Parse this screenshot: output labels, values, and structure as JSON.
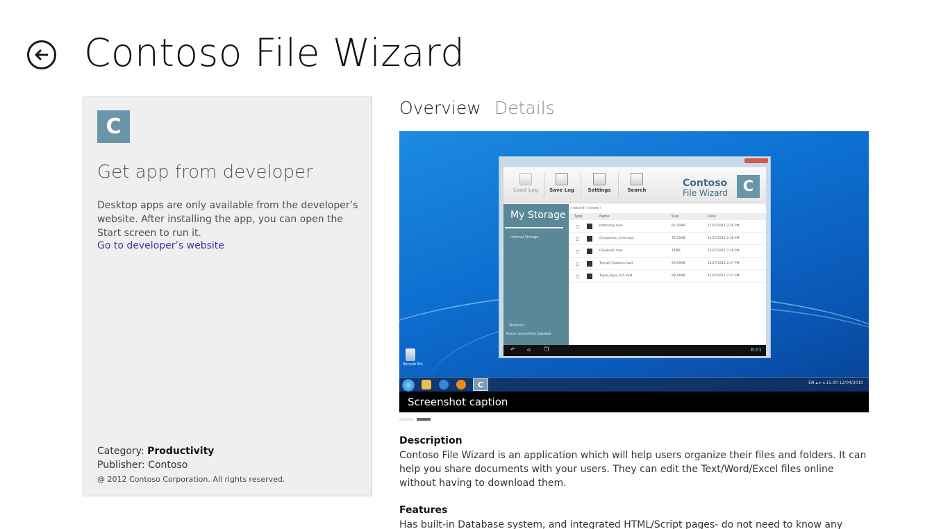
{
  "header": {
    "title": "Contoso File Wizard"
  },
  "card": {
    "tile_letter": "C",
    "heading": "Get app from developer",
    "description": "Desktop apps are only available from the developer’s website. After installing the app, you can open the Start screen to run it.",
    "link": "Go to developer’s website",
    "category_label": "Category:",
    "category_value": "Productivity",
    "publisher_label": "Publisher:",
    "publisher_value": "Contoso",
    "copyright": "@ 2012 Contoso Corporation. All rights reserved."
  },
  "tabs": [
    {
      "label": "Overview",
      "active": true
    },
    {
      "label": "Details",
      "active": false
    }
  ],
  "screenshot": {
    "caption": "Screenshot caption",
    "pager_count": 2,
    "active_page": 2,
    "app": {
      "toolbar": [
        "Load Log",
        "Save Log",
        "Settings",
        "Search"
      ],
      "logo_line1": "Contoso",
      "logo_line2": "File Wizard",
      "logo_letter": "C",
      "sidebar_title": "My Storage",
      "sidebar_item": "Internal Storage",
      "shortcut_label": "Shortcut",
      "shortcuts": "Picture  Camera  Music  Download",
      "path": "/ sdcard / videos /",
      "columns": [
        "Type",
        "Name",
        "Size",
        "Date"
      ],
      "files": [
        {
          "name": "battleship.mp4",
          "size": "85.56MB",
          "date": "11/27/2011 2:36 PM"
        },
        {
          "name": "Companion_Core.mp4",
          "size": "79.55MB",
          "date": "11/27/2011 2:36 PM"
        },
        {
          "name": "Glowball2.mp4",
          "size": "14MB",
          "date": "11/27/2011 2:36 PM"
        },
        {
          "name": "Tegra3_Features.mp4",
          "size": "93.63MB",
          "date": "11/27/2011 2:37 PM"
        },
        {
          "name": "Tegra_Apps_5x5.mp4",
          "size": "98.14MB",
          "date": "11/27/2011 2:37 PM"
        }
      ],
      "clock": "6:01"
    },
    "desktop": {
      "recycle_label": "Recycle Bin",
      "taskbar_letter": "C",
      "tray": "EN  ▴  ▸  ◂  11:00  12/04/2010"
    },
    "colors": {
      "accent": "#6b95a8",
      "desktop": "#0d6fd0"
    }
  },
  "description": {
    "title": "Description",
    "body": "Contoso File Wizard is an application which will help users organize their files and folders. It can help you share documents with your users. They can edit the Text/Word/Excel files online without having to download them."
  },
  "features": {
    "title": "Features",
    "body": "Has built-in Database system, and integrated HTML/Script pages- do not need to know any"
  },
  "icons": {
    "back": "back-arrow-icon"
  }
}
